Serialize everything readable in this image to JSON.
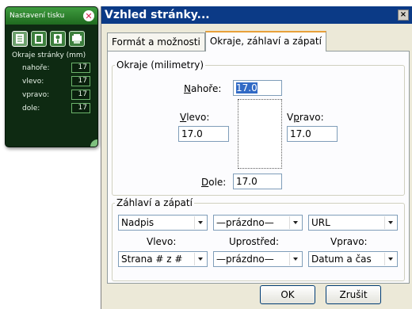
{
  "panel": {
    "title": "Nastavení tisku",
    "subtitle": "Okraje stránky (mm)",
    "icons": [
      "page-format-icon",
      "page-icon",
      "header-icon",
      "footer-icon"
    ],
    "rows": [
      {
        "label": "nahoře:",
        "value": "17"
      },
      {
        "label": "vlevo:",
        "value": "17"
      },
      {
        "label": "vpravo:",
        "value": "17"
      },
      {
        "label": "dole:",
        "value": "17"
      }
    ]
  },
  "dialog": {
    "title": "Vzhled stránky...",
    "close": "×",
    "tabs": [
      {
        "label": "Formát a možnosti",
        "active": false
      },
      {
        "label": "Okraje, záhlaví a zápatí",
        "active": true
      }
    ],
    "margins": {
      "group_label": "Okraje (milimetry)",
      "top_label": "Nahoře:",
      "top_value": "17.0",
      "left_label": "Vlevo:",
      "left_value": "17.0",
      "right_label": "Vpravo:",
      "right_value": "17.0",
      "bottom_label": "Dole:",
      "bottom_value": "17.0"
    },
    "headers": {
      "group_label": "Záhlaví a zápatí",
      "header_left": "Nadpis",
      "header_center": "—prázdno—",
      "header_right": "URL",
      "col_left": "Vlevo:",
      "col_center": "Uprostřed:",
      "col_right": "Vpravo:",
      "footer_left": "Strana # z #",
      "footer_center": "—prázdno—",
      "footer_right": "Datum a čas"
    },
    "ok_label": "OK",
    "cancel_label": "Zrušit"
  },
  "colors": {
    "panel_bg": "#0e2a12",
    "panel_header": "#3f9c3f",
    "dialog_title_bar": "#0b3a86",
    "dialog_bg": "#ece9d8",
    "active_tab_accent": "#e8a03a",
    "selection": "#316ac5"
  }
}
